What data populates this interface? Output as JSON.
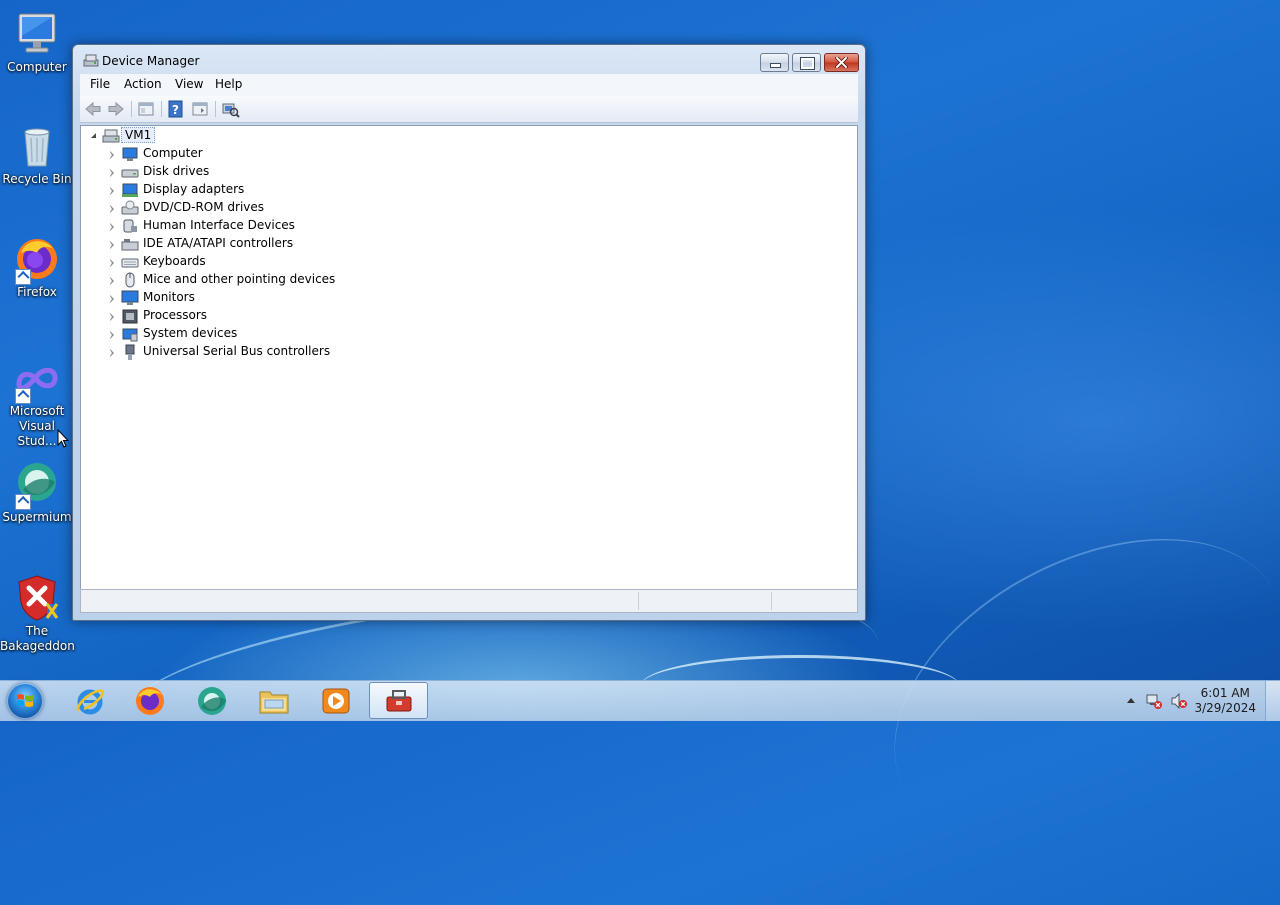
{
  "desktop": {
    "icons": [
      {
        "label": "Computer"
      },
      {
        "label": "Recycle Bin"
      },
      {
        "label": "Firefox"
      },
      {
        "label": "Microsoft Visual Stud..."
      },
      {
        "label": "Supermium"
      },
      {
        "label": "The Bakageddon"
      }
    ]
  },
  "window": {
    "title": "Device Manager",
    "menu": [
      "File",
      "Action",
      "View",
      "Help"
    ],
    "tree": {
      "root": "VM1",
      "items": [
        {
          "label": "Computer",
          "icon": "computer-icon"
        },
        {
          "label": "Disk drives",
          "icon": "disk-drive-icon"
        },
        {
          "label": "Display adapters",
          "icon": "display-adapter-icon"
        },
        {
          "label": "DVD/CD-ROM drives",
          "icon": "dvd-drive-icon"
        },
        {
          "label": "Human Interface Devices",
          "icon": "hid-icon"
        },
        {
          "label": "IDE ATA/ATAPI controllers",
          "icon": "ide-controller-icon"
        },
        {
          "label": "Keyboards",
          "icon": "keyboard-icon"
        },
        {
          "label": "Mice and other pointing devices",
          "icon": "mouse-icon"
        },
        {
          "label": "Monitors",
          "icon": "monitor-icon"
        },
        {
          "label": "Processors",
          "icon": "processor-icon"
        },
        {
          "label": "System devices",
          "icon": "system-devices-icon"
        },
        {
          "label": "Universal Serial Bus controllers",
          "icon": "usb-icon"
        }
      ]
    }
  },
  "taskbar": {
    "apps": [
      "internet-explorer-icon",
      "firefox-icon",
      "supermium-icon",
      "file-explorer-icon",
      "media-player-icon",
      "device-manager-icon"
    ],
    "clock": {
      "time": "6:01 AM",
      "date": "3/29/2024"
    }
  },
  "colors": {
    "desktop": "#1d73d3",
    "titlebar": "#c6d8ee",
    "close_button": "#c0361c"
  }
}
